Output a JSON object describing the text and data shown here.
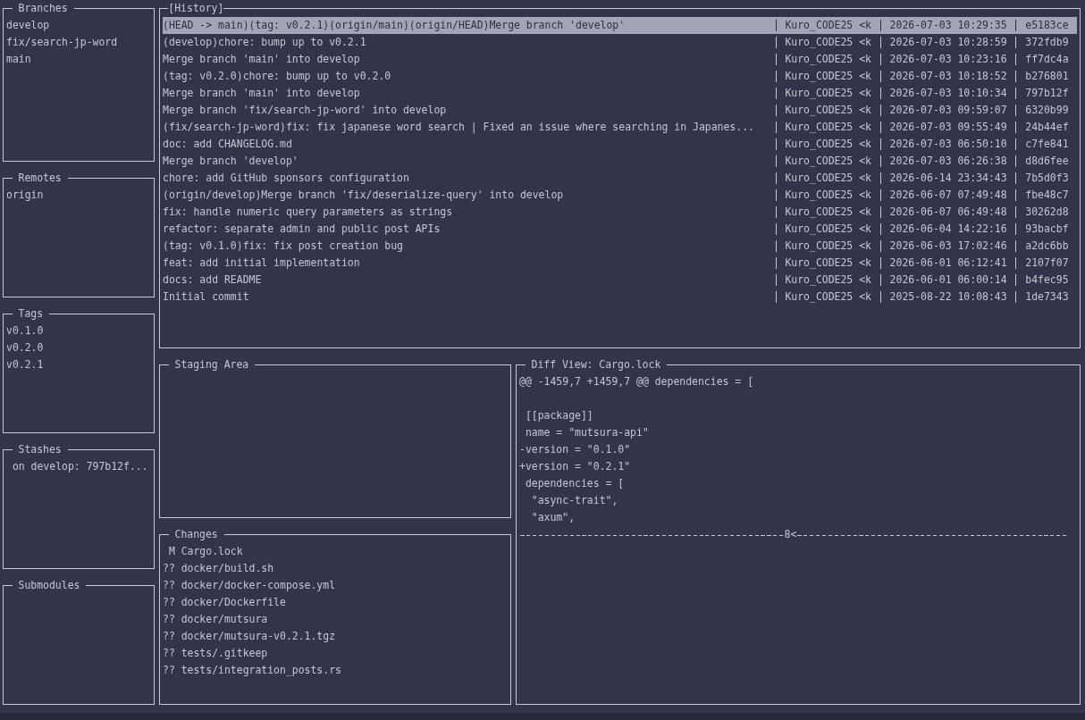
{
  "sidebar": {
    "branches": {
      "title": "Branches",
      "items": [
        "develop",
        "fix/search-jp-word",
        "main"
      ]
    },
    "remotes": {
      "title": "Remotes",
      "items": [
        "origin"
      ]
    },
    "tags": {
      "title": "Tags",
      "items": [
        "v0.1.0",
        "v0.2.0",
        "v0.2.1"
      ]
    },
    "stashes": {
      "title": "Stashes",
      "items": [
        "on develop: 797b12f..."
      ]
    },
    "submodules": {
      "title": "Submodules"
    }
  },
  "history": {
    "title": "[History]",
    "commits": [
      {
        "message": "(HEAD -> main)(tag: v0.2.1)(origin/main)(origin/HEAD)Merge branch 'develop'",
        "author": "Kuro_CODE25 <k",
        "date": "2026-07-03 10:29:35",
        "hash": "e5183ce",
        "selected": true
      },
      {
        "message": "(develop)chore: bump up to v0.2.1",
        "author": "Kuro_CODE25 <k",
        "date": "2026-07-03 10:28:59",
        "hash": "372fdb9",
        "selected": false
      },
      {
        "message": "Merge branch 'main' into develop",
        "author": "Kuro_CODE25 <k",
        "date": "2026-07-03 10:23:16",
        "hash": "ff7dc4a",
        "selected": false
      },
      {
        "message": "(tag: v0.2.0)chore: bump up to v0.2.0",
        "author": "Kuro_CODE25 <k",
        "date": "2026-07-03 10:18:52",
        "hash": "b276801",
        "selected": false
      },
      {
        "message": "Merge branch 'main' into develop",
        "author": "Kuro_CODE25 <k",
        "date": "2026-07-03 10:10:34",
        "hash": "797b12f",
        "selected": false
      },
      {
        "message": "Merge branch 'fix/search-jp-word' into develop",
        "author": "Kuro_CODE25 <k",
        "date": "2026-07-03 09:59:07",
        "hash": "6320b99",
        "selected": false
      },
      {
        "message": "(fix/search-jp-word)fix: fix japanese word search | Fixed an issue where searching in Japanes...",
        "author": "Kuro_CODE25 <k",
        "date": "2026-07-03 09:55:49",
        "hash": "24b44ef",
        "selected": false
      },
      {
        "message": "doc: add CHANGELOG.md",
        "author": "Kuro_CODE25 <k",
        "date": "2026-07-03 06:50:10",
        "hash": "c7fe841",
        "selected": false
      },
      {
        "message": "Merge branch 'develop'",
        "author": "Kuro_CODE25 <k",
        "date": "2026-07-03 06:26:38",
        "hash": "d8d6fee",
        "selected": false
      },
      {
        "message": "chore: add GitHub sponsors configuration",
        "author": "Kuro_CODE25 <k",
        "date": "2026-06-14 23:34:43",
        "hash": "7b5d0f3",
        "selected": false
      },
      {
        "message": "(origin/develop)Merge branch 'fix/deserialize-query' into develop",
        "author": "Kuro_CODE25 <k",
        "date": "2026-06-07 07:49:48",
        "hash": "fbe48c7",
        "selected": false
      },
      {
        "message": "fix: handle numeric query parameters as strings",
        "author": "Kuro_CODE25 <k",
        "date": "2026-06-07 06:49:48",
        "hash": "30262d8",
        "selected": false
      },
      {
        "message": "refactor: separate admin and public post APIs",
        "author": "Kuro_CODE25 <k",
        "date": "2026-06-04 14:22:16",
        "hash": "93bacbf",
        "selected": false
      },
      {
        "message": "(tag: v0.1.0)fix: fix post creation bug",
        "author": "Kuro_CODE25 <k",
        "date": "2026-06-03 17:02:46",
        "hash": "a2dc6bb",
        "selected": false
      },
      {
        "message": "feat: add initial implementation",
        "author": "Kuro_CODE25 <k",
        "date": "2026-06-01 06:12:41",
        "hash": "2107f07",
        "selected": false
      },
      {
        "message": "docs: add README",
        "author": "Kuro_CODE25 <k",
        "date": "2026-06-01 06:00:14",
        "hash": "b4fec95",
        "selected": false
      },
      {
        "message": "Initial commit",
        "author": "Kuro_CODE25 <k",
        "date": "2025-08-22 10:08:43",
        "hash": "1de7343",
        "selected": false
      }
    ]
  },
  "staging_area": {
    "title": "Staging Area"
  },
  "changes": {
    "title": "Changes",
    "files": [
      {
        "status": "M",
        "path": "Cargo.lock"
      },
      {
        "status": "??",
        "path": "docker/build.sh"
      },
      {
        "status": "??",
        "path": "docker/docker-compose.yml"
      },
      {
        "status": "??",
        "path": "docker/Dockerfile"
      },
      {
        "status": "??",
        "path": "docker/mutsura"
      },
      {
        "status": "??",
        "path": "docker/mutsura-v0.2.1.tgz"
      },
      {
        "status": "??",
        "path": "tests/.gitkeep"
      },
      {
        "status": "??",
        "path": "tests/integration_posts.rs"
      }
    ]
  },
  "diff_view": {
    "title": "Diff View: Cargo.lock",
    "lines": [
      {
        "kind": "line",
        "text": "@@ -1459,7 +1459,7 @@ dependencies = ["
      },
      {
        "kind": "blank"
      },
      {
        "kind": "line",
        "text": " [[package]]"
      },
      {
        "kind": "line",
        "text": " name = \"mutsura-api\""
      },
      {
        "kind": "line",
        "text": "-version = \"0.1.0\""
      },
      {
        "kind": "line",
        "text": "+version = \"0.2.1\""
      },
      {
        "kind": "line",
        "text": " dependencies = ["
      },
      {
        "kind": "line",
        "text": "  \"async-trait\","
      },
      {
        "kind": "line",
        "text": "  \"axum\","
      },
      {
        "kind": "cut",
        "text": "8<"
      }
    ]
  }
}
